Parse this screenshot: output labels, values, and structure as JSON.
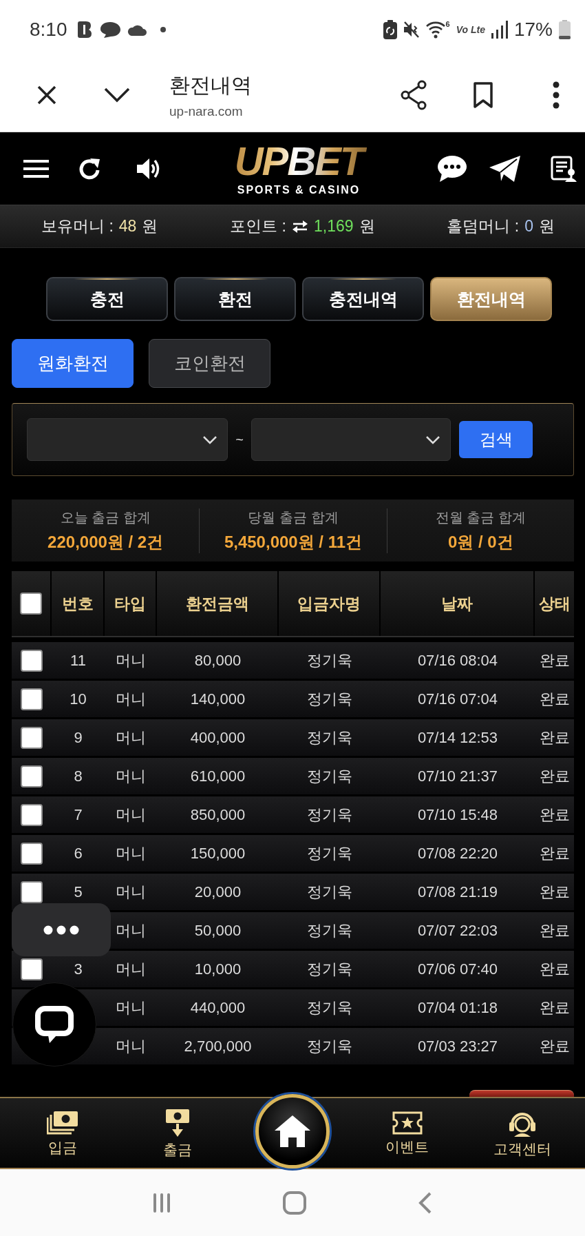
{
  "status_bar": {
    "time": "8:10",
    "wifi_badge": "6",
    "network": "Vo Lte",
    "battery": "17%"
  },
  "browser_bar": {
    "title": "환전내역",
    "url": "up-nara.com"
  },
  "site_header": {
    "logo": "UPBET",
    "tagline": "SPORTS & CASINO"
  },
  "balances": [
    {
      "kind": "plain",
      "label": "보유머니 :",
      "value": "48",
      "unit": "원",
      "color": "#f0e2a8"
    },
    {
      "kind": "point",
      "label": "포인트 :",
      "value": "1,169",
      "unit": "원",
      "color": "#6fe05c"
    },
    {
      "kind": "plain",
      "label": "홀덤머니 :",
      "value": "0",
      "unit": "원",
      "color": "#a8c2ee"
    }
  ],
  "tabs": [
    {
      "label": "충전",
      "selected": false
    },
    {
      "label": "환전",
      "selected": false
    },
    {
      "label": "충전내역",
      "selected": false
    },
    {
      "label": "환전내역",
      "selected": true
    }
  ],
  "subtabs": [
    {
      "label": "원화환전",
      "selected": true
    },
    {
      "label": "코인환전",
      "selected": false
    }
  ],
  "search": {
    "separator": "~",
    "button": "검색"
  },
  "summary": [
    {
      "label": "오늘 출금 합계",
      "value": "220,000원 / 2건"
    },
    {
      "label": "당월 출금 합계",
      "value": "5,450,000원 / 11건"
    },
    {
      "label": "전월 출금 합계",
      "value": "0원 / 0건"
    }
  ],
  "table": {
    "select_all": {
      "checked": false
    },
    "columns": [
      "번호",
      "타입",
      "환전금액",
      "입금자명",
      "날짜",
      "상태"
    ],
    "rows": [
      {
        "checked": false,
        "number": "11",
        "money_type": "머니",
        "amount": "80,000",
        "depositor": "정기욱",
        "date": "07/16 08:04",
        "status": "완료"
      },
      {
        "checked": false,
        "number": "10",
        "money_type": "머니",
        "amount": "140,000",
        "depositor": "정기욱",
        "date": "07/16 07:04",
        "status": "완료"
      },
      {
        "checked": false,
        "number": "9",
        "money_type": "머니",
        "amount": "400,000",
        "depositor": "정기욱",
        "date": "07/14 12:53",
        "status": "완료"
      },
      {
        "checked": false,
        "number": "8",
        "money_type": "머니",
        "amount": "610,000",
        "depositor": "정기욱",
        "date": "07/10 21:37",
        "status": "완료"
      },
      {
        "checked": false,
        "number": "7",
        "money_type": "머니",
        "amount": "850,000",
        "depositor": "정기욱",
        "date": "07/10 15:48",
        "status": "완료"
      },
      {
        "checked": false,
        "number": "6",
        "money_type": "머니",
        "amount": "150,000",
        "depositor": "정기욱",
        "date": "07/08 22:20",
        "status": "완료"
      },
      {
        "checked": false,
        "number": "5",
        "money_type": "머니",
        "amount": "20,000",
        "depositor": "정기욱",
        "date": "07/08 21:19",
        "status": "완료"
      },
      {
        "money_type": "머니",
        "amount": "50,000",
        "depositor": "정기욱",
        "date": "07/07 22:03",
        "status": "완료"
      },
      {
        "checked": false,
        "number": "3",
        "money_type": "머니",
        "amount": "10,000",
        "depositor": "정기욱",
        "date": "07/06 07:40",
        "status": "완료"
      },
      {
        "money_type": "머니",
        "amount": "440,000",
        "depositor": "정기욱",
        "date": "07/04 01:18",
        "status": "완료"
      },
      {
        "money_type": "머니",
        "amount": "2,700,000",
        "depositor": "정기욱",
        "date": "07/03 23:27",
        "status": "완료"
      }
    ]
  },
  "bottom_nav": [
    {
      "kind": "deposit",
      "label": "입금"
    },
    {
      "kind": "withdraw",
      "label": "출금"
    },
    {
      "kind": "home"
    },
    {
      "kind": "event",
      "label": "이벤트"
    },
    {
      "kind": "support",
      "label": "고객센터"
    }
  ]
}
